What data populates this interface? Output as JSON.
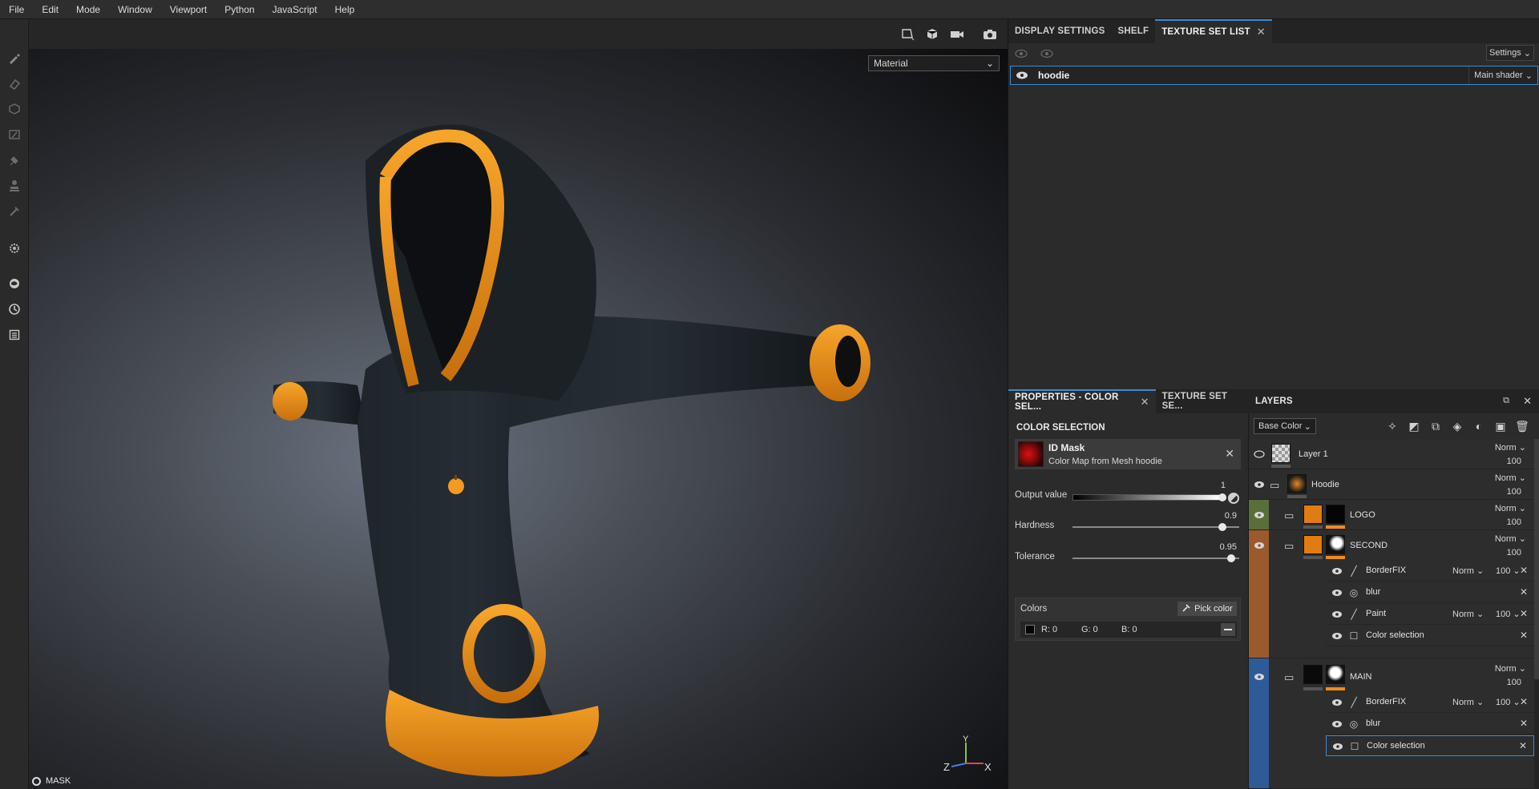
{
  "menu": [
    "File",
    "Edit",
    "Mode",
    "Window",
    "Viewport",
    "Python",
    "JavaScript",
    "Help"
  ],
  "viewport": {
    "material_mode": "Material",
    "mask_label": "MASK",
    "axes": {
      "y": "Y",
      "z": "Z",
      "x": "X"
    }
  },
  "top_tabs": [
    {
      "label": "DISPLAY SETTINGS",
      "active": false
    },
    {
      "label": "SHELF",
      "active": false
    },
    {
      "label": "TEXTURE SET LIST",
      "active": true,
      "close": "✕"
    }
  ],
  "texture_set_list": {
    "settings_label": "Settings",
    "item_name": "hoodie",
    "shader": "Main shader"
  },
  "properties": {
    "tabs": [
      {
        "label": "PROPERTIES - COLOR SEL...",
        "active": true,
        "close": "✕"
      },
      {
        "label": "TEXTURE SET SE...",
        "active": false
      }
    ],
    "section_title": "COLOR SELECTION",
    "id_mask_title": "ID Mask",
    "id_mask_sub": "Color Map from Mesh hoodie",
    "output_value_label": "Output value",
    "output_value": "1",
    "output_value_level": 1,
    "hardness_label": "Hardness",
    "hardness": "0.9",
    "hardness_level": 0.9,
    "tolerance_label": "Tolerance",
    "tolerance": "0.95",
    "tolerance_level": 0.95,
    "colors_label": "Colors",
    "pick_color": "Pick color",
    "color_r": "R: 0",
    "color_g": "G: 0",
    "color_b": "B: 0"
  },
  "layers_panel": {
    "title": "LAYERS",
    "channel": "Base Color"
  },
  "layers": {
    "layer1": {
      "name": "Layer 1",
      "blend": "Norm",
      "opacity": "100"
    },
    "hoodie": {
      "name": "Hoodie",
      "blend": "Norm",
      "opacity": "100"
    },
    "logo": {
      "name": "LOGO",
      "blend": "Norm",
      "opacity": "100"
    },
    "second": {
      "name": "SECOND",
      "blend": "Norm",
      "opacity": "100"
    },
    "second_effects": [
      {
        "name": "BorderFIX",
        "blend": "Norm",
        "opacity": "100"
      },
      {
        "name": "blur"
      },
      {
        "name": "Paint",
        "blend": "Norm",
        "opacity": "100"
      },
      {
        "name": "Color selection"
      }
    ],
    "main": {
      "name": "MAIN",
      "blend": "Norm",
      "opacity": "100"
    },
    "main_effects": [
      {
        "name": "BorderFIX",
        "blend": "Norm",
        "opacity": "100"
      },
      {
        "name": "blur"
      },
      {
        "name": "Color selection"
      }
    ]
  },
  "colors": {
    "accent": "#3a8ad6",
    "logo_strip": "#5a6e3a",
    "second_strip": "#9a5a2e",
    "main_strip": "#2e5a98",
    "orange": "#f08a1c"
  }
}
